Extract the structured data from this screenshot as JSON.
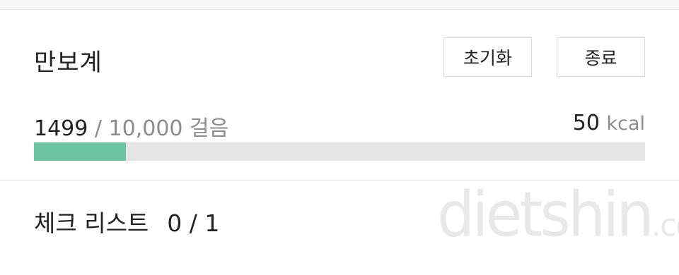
{
  "pedometer": {
    "title": "만보계",
    "reset_label": "초기화",
    "stop_label": "종료",
    "steps_current": "1499",
    "steps_separator": " / ",
    "steps_goal": "10,000 걸음",
    "progress_fraction": 0.1499,
    "progress_color": "#6cc3a2",
    "calories_value": "50",
    "calories_unit": "kcal"
  },
  "checklist": {
    "label": "체크 리스트",
    "count": "0 / 1"
  },
  "watermark": {
    "name": "dietshin",
    "domain": ".com"
  }
}
